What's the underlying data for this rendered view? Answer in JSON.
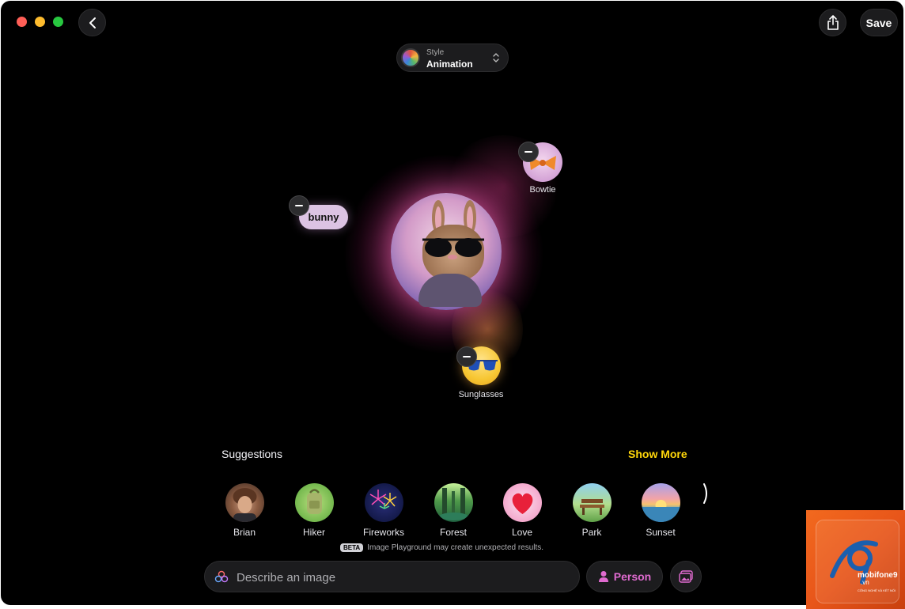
{
  "header": {
    "save_label": "Save",
    "style_picker": {
      "label": "Style",
      "value": "Animation"
    }
  },
  "canvas": {
    "concepts": [
      {
        "label": "bunny"
      },
      {
        "label": "Bowtie"
      },
      {
        "label": "Sunglasses"
      }
    ]
  },
  "suggestions": {
    "title": "Suggestions",
    "show_more_label": "Show More",
    "items": [
      {
        "label": "Brian",
        "icon": "portrait-icon"
      },
      {
        "label": "Hiker",
        "icon": "backpack-icon"
      },
      {
        "label": "Fireworks",
        "icon": "fireworks-icon"
      },
      {
        "label": "Forest",
        "icon": "forest-icon"
      },
      {
        "label": "Love",
        "icon": "heart-icon"
      },
      {
        "label": "Park",
        "icon": "bench-icon"
      },
      {
        "label": "Sunset",
        "icon": "sunset-icon"
      }
    ]
  },
  "footer": {
    "beta_badge": "BETA",
    "beta_notice": "Image Playground may create unexpected results.",
    "prompt_placeholder": "Describe an image",
    "person_label": "Person"
  },
  "watermark": {
    "brand": "mobifone9",
    "domain": ".vn",
    "tagline": "CÔNG NGHỆ VÀ KẾT NỐI"
  },
  "colors": {
    "accent_yellow": "#ffd60a",
    "person_accent": "#e06bd0",
    "background": "#000000"
  }
}
